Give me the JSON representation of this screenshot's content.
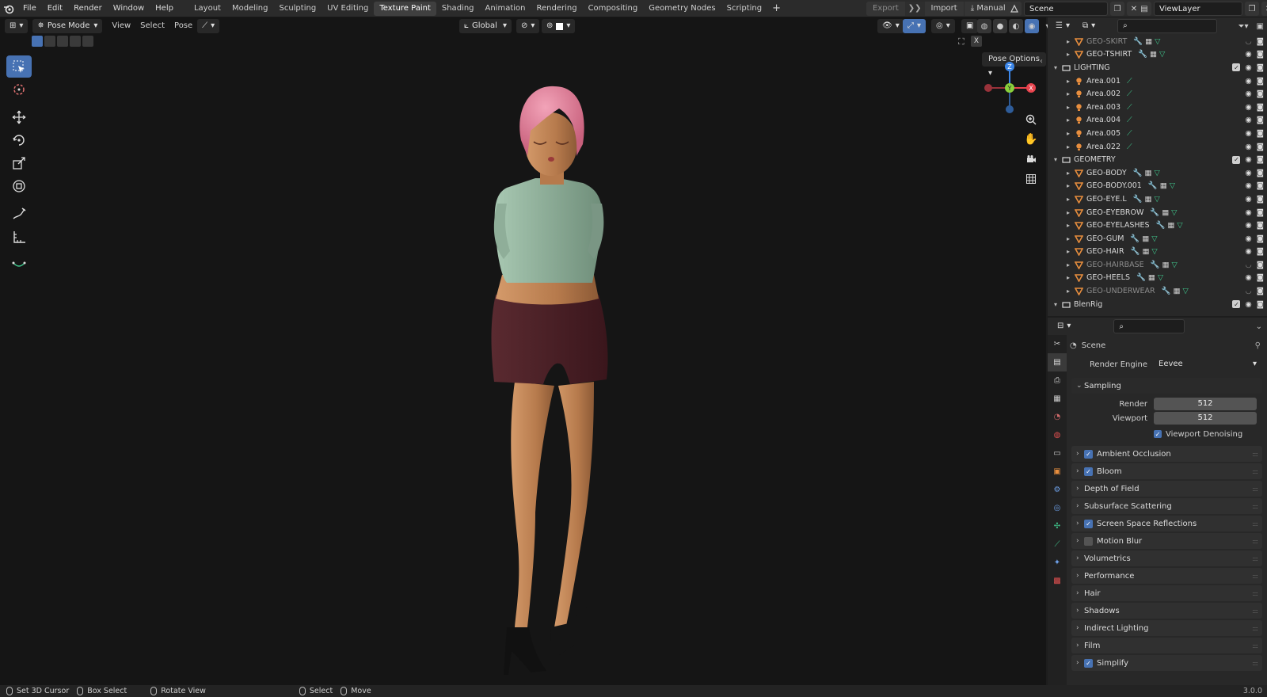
{
  "menu": {
    "items": [
      "File",
      "Edit",
      "Render",
      "Window",
      "Help"
    ]
  },
  "workspaces": {
    "tabs": [
      "Layout",
      "Modeling",
      "Sculpting",
      "UV Editing",
      "Texture Paint",
      "Shading",
      "Animation",
      "Rendering",
      "Compositing",
      "Geometry Nodes",
      "Scripting"
    ],
    "active": "Texture Paint",
    "add_label": "+"
  },
  "topright": {
    "export_label": "Export",
    "import_label": "Import",
    "manual_label": "Manual",
    "scene_name": "Scene",
    "viewlayer_name": "ViewLayer"
  },
  "viewport": {
    "mode_label": "Pose Mode",
    "menus": [
      "View",
      "Select",
      "Pose"
    ],
    "transform_orientation": "Global",
    "pose_options_label": "Pose Options",
    "gizmo": {
      "z": "Z",
      "y": "Y",
      "x": "X"
    }
  },
  "outliner": {
    "rows": [
      {
        "name": "GEO-SKIRT",
        "type": "mesh",
        "level": 1,
        "dim": true,
        "expand": "▸"
      },
      {
        "name": "GEO-TSHIRT",
        "type": "mesh",
        "level": 1,
        "dim": false,
        "expand": "▸"
      },
      {
        "name": "LIGHTING",
        "type": "collection",
        "level": 0,
        "dim": false,
        "expand": "▾"
      },
      {
        "name": "Area.001",
        "type": "light",
        "level": 1,
        "dim": false,
        "expand": "▸"
      },
      {
        "name": "Area.002",
        "type": "light",
        "level": 1,
        "dim": false,
        "expand": "▸"
      },
      {
        "name": "Area.003",
        "type": "light",
        "level": 1,
        "dim": false,
        "expand": "▸"
      },
      {
        "name": "Area.004",
        "type": "light",
        "level": 1,
        "dim": false,
        "expand": "▸"
      },
      {
        "name": "Area.005",
        "type": "light",
        "level": 1,
        "dim": false,
        "expand": "▸"
      },
      {
        "name": "Area.022",
        "type": "light",
        "level": 1,
        "dim": false,
        "expand": "▸"
      },
      {
        "name": "GEOMETRY",
        "type": "collection",
        "level": 0,
        "dim": false,
        "expand": "▾"
      },
      {
        "name": "GEO-BODY",
        "type": "mesh",
        "level": 1,
        "dim": false,
        "expand": "▸"
      },
      {
        "name": "GEO-BODY.001",
        "type": "mesh",
        "level": 1,
        "dim": false,
        "expand": "▸"
      },
      {
        "name": "GEO-EYE.L",
        "type": "mesh",
        "level": 1,
        "dim": false,
        "expand": "▸"
      },
      {
        "name": "GEO-EYEBROW",
        "type": "mesh",
        "level": 1,
        "dim": false,
        "expand": "▸"
      },
      {
        "name": "GEO-EYELASHES",
        "type": "mesh",
        "level": 1,
        "dim": false,
        "expand": "▸"
      },
      {
        "name": "GEO-GUM",
        "type": "mesh",
        "level": 1,
        "dim": false,
        "expand": "▸"
      },
      {
        "name": "GEO-HAIR",
        "type": "mesh",
        "level": 1,
        "dim": false,
        "expand": "▸"
      },
      {
        "name": "GEO-HAIRBASE",
        "type": "mesh",
        "level": 1,
        "dim": true,
        "expand": "▸"
      },
      {
        "name": "GEO-HEELS",
        "type": "mesh",
        "level": 1,
        "dim": false,
        "expand": "▸"
      },
      {
        "name": "GEO-UNDERWEAR",
        "type": "mesh",
        "level": 1,
        "dim": true,
        "expand": "▸"
      },
      {
        "name": "BlenRig",
        "type": "collection",
        "level": 0,
        "dim": false,
        "expand": "▾"
      }
    ]
  },
  "properties": {
    "context": "Scene",
    "render_engine_label": "Render Engine",
    "render_engine_value": "Eevee",
    "sampling": {
      "title": "Sampling",
      "render_label": "Render",
      "render_value": "512",
      "viewport_label": "Viewport",
      "viewport_value": "512",
      "denoise_label": "Viewport Denoising"
    },
    "panels": [
      {
        "label": "Ambient Occlusion",
        "checkbox": "on"
      },
      {
        "label": "Bloom",
        "checkbox": "on"
      },
      {
        "label": "Depth of Field",
        "checkbox": "none"
      },
      {
        "label": "Subsurface Scattering",
        "checkbox": "none"
      },
      {
        "label": "Screen Space Reflections",
        "checkbox": "on"
      },
      {
        "label": "Motion Blur",
        "checkbox": "off"
      },
      {
        "label": "Volumetrics",
        "checkbox": "none"
      },
      {
        "label": "Performance",
        "checkbox": "none"
      },
      {
        "label": "Hair",
        "checkbox": "none"
      },
      {
        "label": "Shadows",
        "checkbox": "none"
      },
      {
        "label": "Indirect Lighting",
        "checkbox": "none"
      },
      {
        "label": "Film",
        "checkbox": "none"
      },
      {
        "label": "Simplify",
        "checkbox": "on"
      }
    ]
  },
  "statusbar": {
    "items": [
      "Set 3D Cursor",
      "Box Select",
      "Rotate View",
      "Select",
      "Move"
    ],
    "version": "3.0.0"
  },
  "colors": {
    "accent": "#4772b3",
    "mesh_icon": "#e88e3e",
    "modifier_icon": "#6ea0e8",
    "data_icon": "#3fc28a",
    "axis_x": "#e8434d",
    "axis_y": "#8ad03c",
    "axis_z": "#3c86e8"
  }
}
